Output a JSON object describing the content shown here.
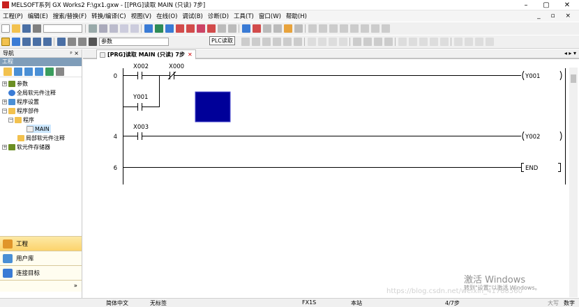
{
  "window": {
    "title": "MELSOFT系列 GX Works2 F:\\gx1.gxw - [[PRG]读取 MAIN (只读) 7步]",
    "minimize": "–",
    "maximize": "▢",
    "close": "✕"
  },
  "menu": {
    "items": [
      "工程(P)",
      "编辑(E)",
      "搜索/替换(F)",
      "转换/编译(C)",
      "视图(V)",
      "在线(O)",
      "调试(B)",
      "诊断(D)",
      "工具(T)",
      "窗口(W)",
      "帮助(H)"
    ],
    "mdi_controls": "_ ▫ ×"
  },
  "toolbar": {
    "combo_value": "参数",
    "tooltip": "PLC读取"
  },
  "navigation": {
    "title": "导航",
    "pin": "ᵖ ×",
    "subtitle": "工程",
    "tree": [
      {
        "label": "参数",
        "expander": "+"
      },
      {
        "label": "全局软元件注释",
        "expander": ""
      },
      {
        "label": "程序设置",
        "expander": "+"
      },
      {
        "label": "程序部件",
        "expander": "−"
      },
      {
        "label": "程序",
        "expander": "−"
      },
      {
        "label": "MAIN",
        "expander": ""
      },
      {
        "label": "局部软元件注释",
        "expander": ""
      },
      {
        "label": "软元件存储器",
        "expander": "+"
      }
    ],
    "buttons": [
      "工程",
      "用户库",
      "连接目标"
    ],
    "expand": "»"
  },
  "tabs": {
    "active": "[PRG]读取 MAIN (只读) 7步",
    "close": "✕",
    "scroll": "◂ ▸ ▾"
  },
  "ladder": {
    "steps": [
      "0",
      "4",
      "6"
    ],
    "contacts": [
      "X002",
      "X000",
      "Y001",
      "X003"
    ],
    "coils": [
      "Y001",
      "Y002"
    ],
    "instructions": [
      "END"
    ],
    "cursor_color": "#000099"
  },
  "status": {
    "language": "简体中文",
    "label": "无标签",
    "plc": "FX1S",
    "station": "本站",
    "step": "4/7步",
    "caps": "大写",
    "num": "数字"
  },
  "watermark": {
    "line1": "激活 Windows",
    "line2": "转到\"设置\"以激活 Windows。",
    "url": "https://blog.csdn.net/weixin_41788560"
  }
}
